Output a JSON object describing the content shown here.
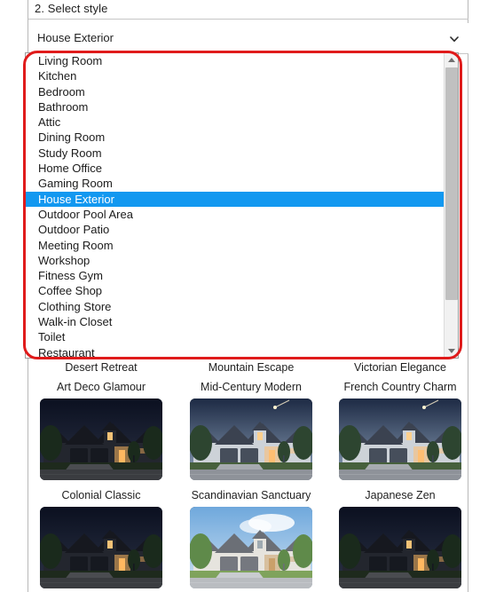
{
  "step": {
    "label": "2. Select style"
  },
  "select": {
    "name": "style-select",
    "value": "House Exterior",
    "chevron_icon": "chevron-down-icon",
    "expanded": true
  },
  "dropdown": {
    "selected_index": 9,
    "options": [
      "Living Room",
      "Kitchen",
      "Bedroom",
      "Bathroom",
      "Attic",
      "Dining Room",
      "Study Room",
      "Home Office",
      "Gaming Room",
      "House Exterior",
      "Outdoor Pool Area",
      "Outdoor Patio",
      "Meeting Room",
      "Workshop",
      "Fitness Gym",
      "Coffee Shop",
      "Clothing Store",
      "Walk-in Closet",
      "Toilet",
      "Restaurant"
    ],
    "scrollbar": {
      "up_arrow_icon": "triangle-up-icon",
      "down_arrow_icon": "triangle-down-icon"
    }
  },
  "annotation": {
    "highlight_color": "#e01b1b",
    "shape": "rounded-rectangle"
  },
  "colors": {
    "selection_blue": "#1298f0",
    "annotation_red": "#e01b1b",
    "border_gray": "#b9b9b9"
  },
  "gallery": {
    "rows": [
      {
        "labels_only": true,
        "items": [
          {
            "label": "Desert Retreat",
            "scene": "night"
          },
          {
            "label": "Mountain Escape",
            "scene": "night"
          },
          {
            "label": "Victorian Elegance",
            "scene": "night"
          }
        ]
      },
      {
        "labels_only": false,
        "items": [
          {
            "label": "Art Deco Glamour",
            "scene": "night"
          },
          {
            "label": "Mid-Century Modern",
            "scene": "dusk"
          },
          {
            "label": "French Country Charm",
            "scene": "dusk"
          }
        ]
      },
      {
        "labels_only": false,
        "items": [
          {
            "label": "Colonial Classic",
            "scene": "night"
          },
          {
            "label": "Scandinavian Sanctuary",
            "scene": "day"
          },
          {
            "label": "Japanese Zen",
            "scene": "night"
          }
        ]
      }
    ]
  }
}
